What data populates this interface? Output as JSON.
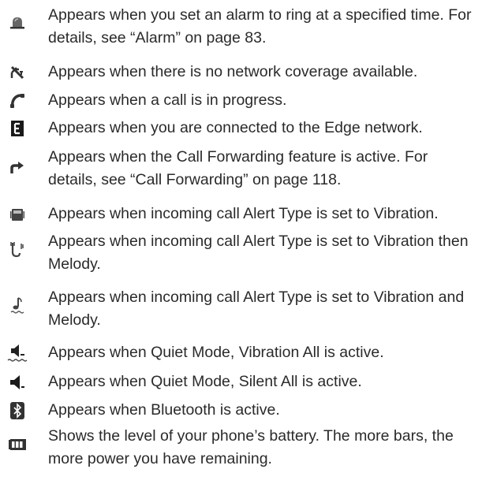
{
  "items": [
    {
      "icon": "alarm-bell-icon",
      "text": "Appears when you set an alarm to ring at a specified time. For details, see “Alarm” on page 83."
    },
    {
      "icon": "no-network-icon",
      "text": "Appears when there is no network coverage available."
    },
    {
      "icon": "call-in-progress-icon",
      "text": "Appears when a call is in progress."
    },
    {
      "icon": "edge-network-icon",
      "text": "Appears when you are connected to the Edge network."
    },
    {
      "icon": "call-forwarding-icon",
      "text": "Appears when the Call Forwarding feature is active. For details, see “Call Forwarding” on page 118."
    },
    {
      "icon": "vibration-icon",
      "text": "Appears when incoming call Alert Type is set to Vibration."
    },
    {
      "icon": "vibration-then-melody-icon",
      "text": "Appears when incoming call Alert Type is set to Vibration then Melody."
    },
    {
      "icon": "vibration-and-melody-icon",
      "text": "Appears when incoming call Alert Type is set to Vibration and Melody."
    },
    {
      "icon": "quiet-vibration-all-icon",
      "text": "Appears when Quiet Mode, Vibration All is active."
    },
    {
      "icon": "quiet-silent-all-icon",
      "text": "Appears when Quiet Mode, Silent All is active."
    },
    {
      "icon": "bluetooth-icon",
      "text": "Appears when Bluetooth is active."
    },
    {
      "icon": "battery-icon",
      "text": "Shows the level of your phone’s battery. The more bars, the more power you have remaining."
    }
  ]
}
